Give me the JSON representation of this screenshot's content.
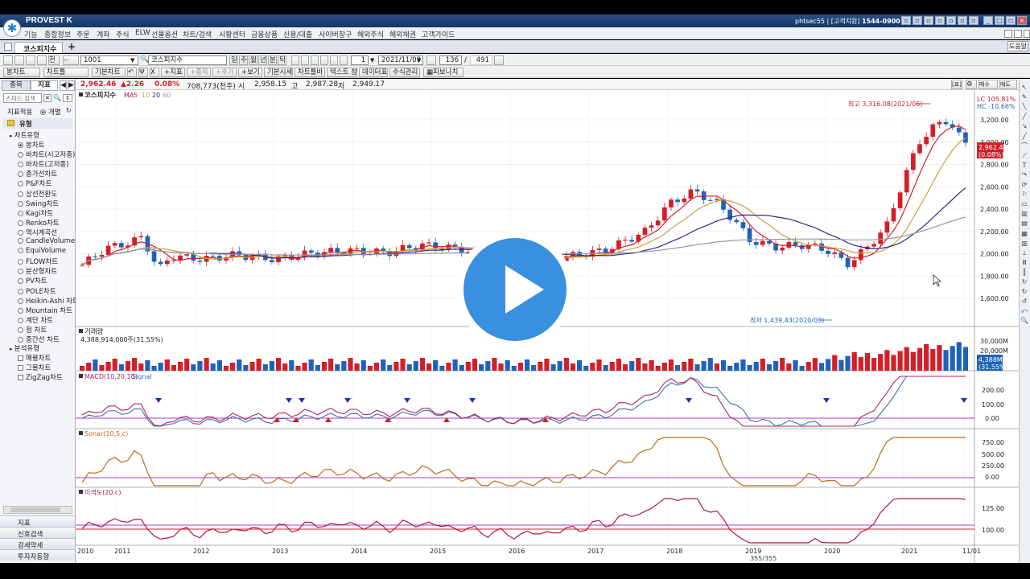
{
  "app": {
    "name": "PROVEST K",
    "user_id": "phtsec55",
    "support_label": "[고객지원]",
    "support_phone": "1544-0900"
  },
  "menu": [
    "기능",
    "종합정보",
    "주문",
    "계좌",
    "주식",
    "ELW",
    "선물옵션",
    "차트/검색",
    "시황센터",
    "금융상품",
    "신용/대출",
    "사이버창구",
    "해외주식",
    "해외채권",
    "고객가이드"
  ],
  "tab": {
    "label": "코스피지수",
    "help": "도움말"
  },
  "toolbar1": {
    "code": "1001",
    "name": "코스피지수",
    "periods": [
      "일",
      "주",
      "월",
      "년",
      "분",
      "틱"
    ],
    "count": "1",
    "date": "2021/11/09",
    "view_count": "136",
    "total": "491"
  },
  "toolbar2": {
    "buttons": [
      "봉차트",
      "차트틀",
      "기본차트",
      "지표",
      "종목",
      "추가",
      "보기",
      "기본시세",
      "차트툴바",
      "텍스트 창",
      "데이터표",
      "수식관리",
      "피보나치"
    ]
  },
  "price": {
    "value": "2,962.46",
    "change": "▲2.26",
    "pct": "0.08%",
    "volume": "708,773(천주)",
    "open_label": "시",
    "open": "2,958.15",
    "high_label": "고",
    "high": "2,987.28",
    "low_label": "저",
    "low": "2,949.17"
  },
  "sidebar": {
    "tabs": [
      "종목",
      "지표"
    ],
    "search_placeholder": "스피드 검색",
    "apply_label": "지표적용",
    "apply_option": "개별",
    "group_title": "유형",
    "section_chart": "차트유형",
    "chart_types": [
      "봉차트",
      "바차트(시고저종)",
      "바차트(고저종)",
      "종가선차트",
      "P&F차트",
      "삼선전환도",
      "Swing차트",
      "Kagi차트",
      "Renko차트",
      "역시계곡선",
      "CandleVolume",
      "EquiVolume",
      "FLOW차트",
      "분산형차트",
      "PV차트",
      "POLE차트",
      "Heikin-Ashi 차트",
      "Mountain 차트",
      "계단 차트",
      "점 차트",
      "중간선 차트"
    ],
    "section_analysis": "분석유형",
    "analysis_types": [
      "매물차트",
      "그물차트",
      "ZigZag차트"
    ],
    "bottom_tabs": [
      "지표",
      "신호검색",
      "강세약세",
      "투자자동향"
    ]
  },
  "chart": {
    "main_title": "코스피지수",
    "ma_label": "MA",
    "ma_periods": [
      "5",
      "10",
      "20",
      "60"
    ],
    "high_annot": "최고 3,316.08(2021/06)",
    "low_annot": "최저 1,439.43(2020/03)",
    "lc_label": "LC 105.81%",
    "hc_label": "HC -10.66%",
    "price_ticks": [
      "3,200.00",
      "3,000.00",
      "2,800.00",
      "2,600.00",
      "2,400.00",
      "2,200.00",
      "2,000.00",
      "1,800.00",
      "1,600.00"
    ],
    "current_tag": "2,962.46",
    "current_tag_pct": "(0.08%)",
    "x_labels": [
      "2010",
      "2011",
      "2012",
      "2013",
      "2014",
      "2015",
      "2016",
      "2017",
      "2018",
      "2019",
      "2020",
      "2021",
      "11/01"
    ],
    "volume_title": "거래량",
    "volume_value": "4,388,914,000주(31.55%)",
    "volume_ticks": [
      "30,000M",
      "20,000M"
    ],
    "volume_tag": "4,388M",
    "volume_tag_pct": "(31.55%)",
    "macd_title": "MACD(10,20,10)",
    "macd_signal": "Signal",
    "macd_ticks": [
      "200.00",
      "100.00",
      "0.00"
    ],
    "sonar_title": "Sonar(10,5,c)",
    "sonar_ticks": [
      "750.00",
      "500.00",
      "250.00",
      "0.00"
    ],
    "disp_title": "이격도(20,c)",
    "disp_ticks": [
      "125.00",
      "100.00"
    ],
    "scroll_info": "355/355"
  },
  "colors": {
    "up": "#d21f2a",
    "down": "#1f63b8",
    "macd": "#b0245a",
    "signal": "#3b6fb4",
    "sonar": "#c06a1a",
    "disp": "#b01840",
    "ref_line": "#b23acb"
  }
}
